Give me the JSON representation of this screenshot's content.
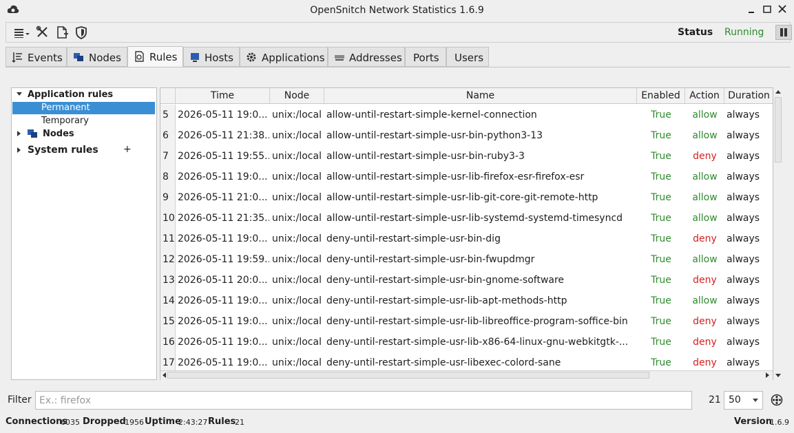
{
  "window": {
    "title": "OpenSnitch Network Statistics 1.6.9"
  },
  "toolbar": {
    "status_label": "Status",
    "status_value": "Running"
  },
  "tabs": [
    {
      "label": "Events"
    },
    {
      "label": "Nodes"
    },
    {
      "label": "Rules"
    },
    {
      "label": "Hosts"
    },
    {
      "label": "Applications"
    },
    {
      "label": "Addresses"
    },
    {
      "label": "Ports"
    },
    {
      "label": "Users"
    }
  ],
  "tree": {
    "app_rules": "Application rules",
    "permanent": "Permanent",
    "temporary": "Temporary",
    "nodes": "Nodes",
    "system_rules": "System rules",
    "add": "+"
  },
  "table": {
    "columns": [
      "Time",
      "Node",
      "Name",
      "Enabled",
      "Action",
      "Duration"
    ],
    "rows": [
      {
        "n": "5",
        "time": "2026-05-11 19:0...",
        "node": "unix:/local",
        "name": "allow-until-restart-simple-kernel-connection",
        "enabled": "True",
        "action": "allow",
        "duration": "always"
      },
      {
        "n": "6",
        "time": "2026-05-11 21:38...",
        "node": "unix:/local",
        "name": "allow-until-restart-simple-usr-bin-python3-13",
        "enabled": "True",
        "action": "allow",
        "duration": "always"
      },
      {
        "n": "7",
        "time": "2026-05-11 19:55...",
        "node": "unix:/local",
        "name": "allow-until-restart-simple-usr-bin-ruby3-3",
        "enabled": "True",
        "action": "deny",
        "duration": "always"
      },
      {
        "n": "8",
        "time": "2026-05-11 19:0...",
        "node": "unix:/local",
        "name": "allow-until-restart-simple-usr-lib-firefox-esr-firefox-esr",
        "enabled": "True",
        "action": "allow",
        "duration": "always"
      },
      {
        "n": "9",
        "time": "2026-05-11 21:0...",
        "node": "unix:/local",
        "name": "allow-until-restart-simple-usr-lib-git-core-git-remote-http",
        "enabled": "True",
        "action": "allow",
        "duration": "always"
      },
      {
        "n": "10",
        "time": "2026-05-11 21:35...",
        "node": "unix:/local",
        "name": "allow-until-restart-simple-usr-lib-systemd-systemd-timesyncd",
        "enabled": "True",
        "action": "allow",
        "duration": "always"
      },
      {
        "n": "11",
        "time": "2026-05-11 19:0...",
        "node": "unix:/local",
        "name": "deny-until-restart-simple-usr-bin-dig",
        "enabled": "True",
        "action": "deny",
        "duration": "always"
      },
      {
        "n": "12",
        "time": "2026-05-11 19:59...",
        "node": "unix:/local",
        "name": "deny-until-restart-simple-usr-bin-fwupdmgr",
        "enabled": "True",
        "action": "allow",
        "duration": "always"
      },
      {
        "n": "13",
        "time": "2026-05-11 20:0...",
        "node": "unix:/local",
        "name": "deny-until-restart-simple-usr-bin-gnome-software",
        "enabled": "True",
        "action": "deny",
        "duration": "always"
      },
      {
        "n": "14",
        "time": "2026-05-11 19:0...",
        "node": "unix:/local",
        "name": "deny-until-restart-simple-usr-lib-apt-methods-http",
        "enabled": "True",
        "action": "allow",
        "duration": "always"
      },
      {
        "n": "15",
        "time": "2026-05-11 19:0...",
        "node": "unix:/local",
        "name": "deny-until-restart-simple-usr-lib-libreoffice-program-soffice-bin",
        "enabled": "True",
        "action": "deny",
        "duration": "always"
      },
      {
        "n": "16",
        "time": "2026-05-11 19:0...",
        "node": "unix:/local",
        "name": "deny-until-restart-simple-usr-lib-x86-64-linux-gnu-webkitgtk-...",
        "enabled": "True",
        "action": "deny",
        "duration": "always"
      },
      {
        "n": "17",
        "time": "2026-05-11 19:0...",
        "node": "unix:/local",
        "name": "deny-until-restart-simple-usr-libexec-colord-sane",
        "enabled": "True",
        "action": "deny",
        "duration": "always"
      }
    ]
  },
  "filter": {
    "label": "Filter",
    "placeholder": "Ex.: firefox",
    "count": "21",
    "limit": "50"
  },
  "statusbar": {
    "connections_label": "Connections",
    "connections": "6035",
    "dropped_label": "Dropped",
    "dropped": "1956",
    "uptime_label": "Uptime",
    "uptime": "2:43:27",
    "rules_label": "Rules",
    "rules": "21",
    "version_label": "Version",
    "version": "1.6.9"
  },
  "colors": {
    "allow": "#2e8b2e",
    "deny": "#d42020",
    "selection": "#3a8fd4"
  }
}
